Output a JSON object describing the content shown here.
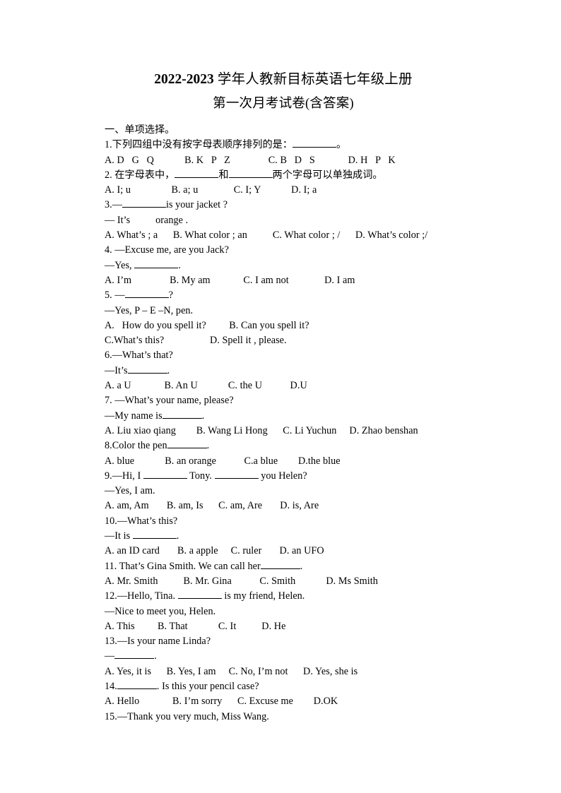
{
  "document": {
    "title_year": "2022-2023",
    "title_rest": " 学年人教新目标英语七年级上册",
    "subtitle": "第一次月考试卷(含答案)"
  },
  "section": {
    "heading": "一、单项选择。"
  },
  "questions": [
    {
      "stem": "1.下列四组中没有按字母表顺序排列的是：",
      "stem_tail": "。",
      "options_line": "A. D   G   Q            B. K   P   Z               C. B   D   S             D. H   P   K"
    },
    {
      "stem_a": "2. 在字母表中，",
      "stem_b": "和",
      "stem_c": "两个字母可以单独成词。",
      "options_line": "A. I; u                B. a; u              C. I; Y            D. I; a"
    },
    {
      "stem": "3.—",
      "stem_tail": "is your jacket ?",
      "answer": "— It’s          orange .",
      "options_line": "A. What’s ; a      B. What color ; an          C. What color ; /      D. What’s color ;/"
    },
    {
      "stem": "4. —Excuse me, are you Jack?",
      "answer_a": "—Yes, ",
      "answer_b": ".",
      "options_line": "A. I’m               B. My am             C. I am not              D. I am"
    },
    {
      "stem": "5. —",
      "stem_tail": "?",
      "answer": "—Yes, P – E –N, pen.",
      "options_line_1": "A.   How do you spell it?         B. Can you spell it?",
      "options_line_2": "C.What’s this?                  D. Spell it , please."
    },
    {
      "stem": "6.—What’s that?",
      "answer_a": "—It’s",
      "answer_b": ".",
      "options_line": "A. a U             B. An U            C. the U           D.U"
    },
    {
      "stem": "7. —What’s your name, please?",
      "answer_a": "—My name is",
      "answer_b": ".",
      "options_line": "A. Liu xiao qiang        B. Wang Li Hong      C. Li Yuchun     D. Zhao benshan"
    },
    {
      "stem_a": "8.Color the pen",
      "stem_b": ".",
      "options_line": "A. blue            B. an orange           C.a blue        D.the blue"
    },
    {
      "stem_a": "9.—Hi, I ",
      "stem_b": " Tony. ",
      "stem_c": " you Helen?",
      "answer": "—Yes, I am.",
      "options_line": "A. am, Am       B. am, Is      C. am, Are       D. is, Are"
    },
    {
      "stem": "10.—What’s this?",
      "answer_a": "—It is ",
      "answer_b": ".",
      "options_line": "A. an ID card       B. a apple     C. ruler       D. an UFO"
    },
    {
      "stem_a": "11. That’s Gina Smith. We can call her",
      "stem_b": ".",
      "options_line": "A. Mr. Smith          B. Mr. Gina           C. Smith            D. Ms Smith"
    },
    {
      "stem_a": "12.—Hello, Tina. ",
      "stem_b": " is my friend, Helen.",
      "answer": "—Nice to meet you, Helen.",
      "options_line": "A. This         B. That            C. It          D. He"
    },
    {
      "stem": "13.—Is your name Linda?",
      "answer_a": "—",
      "answer_b": ".",
      "options_line": "A. Yes, it is      B. Yes, I am     C. No, I’m not      D. Yes, she is"
    },
    {
      "stem_a": "14.",
      "stem_b": ". Is this your pencil case?",
      "options_line": "A. Hello             B. I’m sorry      C. Excuse me        D.OK"
    },
    {
      "stem": "15.—Thank you very much, Miss Wang."
    }
  ]
}
